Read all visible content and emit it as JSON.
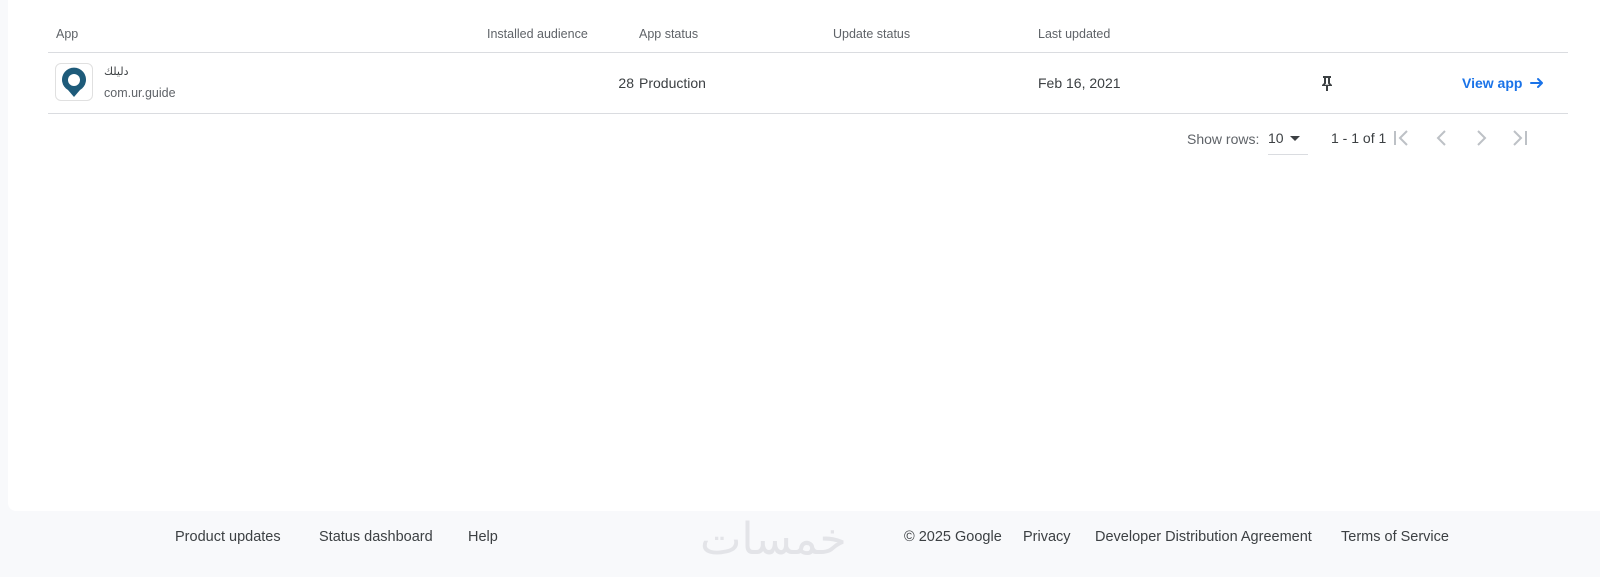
{
  "table": {
    "headers": {
      "app": "App",
      "installed_audience": "Installed audience",
      "app_status": "App status",
      "update_status": "Update status",
      "last_updated": "Last updated"
    },
    "rows": [
      {
        "app_name": "دليلك",
        "package": "com.ur.guide",
        "installed_audience": "28",
        "app_status": "Production",
        "update_status": "",
        "last_updated": "Feb 16, 2021",
        "action_label": "View app",
        "icon": "map-pin-icon",
        "icon_color": "#1e5b7a"
      }
    ]
  },
  "pagination": {
    "show_rows_label": "Show rows:",
    "rows_per_page": "10",
    "range": "1 - 1 of 1"
  },
  "footer": {
    "links": {
      "product_updates": "Product updates",
      "status_dashboard": "Status dashboard",
      "help": "Help",
      "copyright": "© 2025 Google",
      "privacy": "Privacy",
      "dda": "Developer Distribution Agreement",
      "terms": "Terms of Service"
    },
    "watermark": "خمسات"
  },
  "colors": {
    "link": "#1a73e8",
    "divider": "#dadce0",
    "text": "#3c4043",
    "muted": "#5f6368"
  }
}
